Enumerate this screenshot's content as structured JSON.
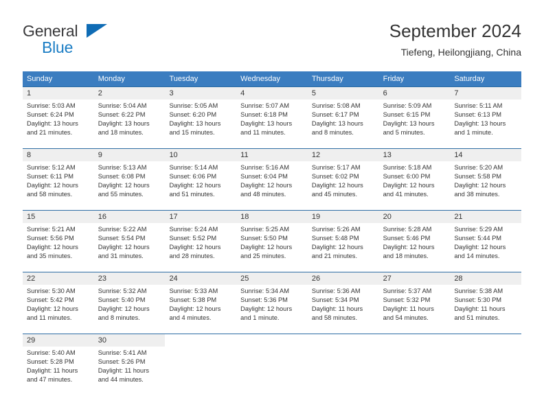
{
  "brand": {
    "name_part1": "General",
    "name_part2": "Blue",
    "logo_icon": "triangle-flag-icon"
  },
  "header": {
    "title": "September 2024",
    "location": "Tiefeng, Heilongjiang, China"
  },
  "colors": {
    "header_blue": "#3b7dc0",
    "row_border_blue": "#2e6da4",
    "day_band_gray": "#efefef",
    "brand_blue": "#1b7dc4",
    "text": "#333333"
  },
  "weekdays": [
    "Sunday",
    "Monday",
    "Tuesday",
    "Wednesday",
    "Thursday",
    "Friday",
    "Saturday"
  ],
  "weeks": [
    [
      {
        "day": "1",
        "sunrise": "Sunrise: 5:03 AM",
        "sunset": "Sunset: 6:24 PM",
        "daylight1": "Daylight: 13 hours",
        "daylight2": "and 21 minutes."
      },
      {
        "day": "2",
        "sunrise": "Sunrise: 5:04 AM",
        "sunset": "Sunset: 6:22 PM",
        "daylight1": "Daylight: 13 hours",
        "daylight2": "and 18 minutes."
      },
      {
        "day": "3",
        "sunrise": "Sunrise: 5:05 AM",
        "sunset": "Sunset: 6:20 PM",
        "daylight1": "Daylight: 13 hours",
        "daylight2": "and 15 minutes."
      },
      {
        "day": "4",
        "sunrise": "Sunrise: 5:07 AM",
        "sunset": "Sunset: 6:18 PM",
        "daylight1": "Daylight: 13 hours",
        "daylight2": "and 11 minutes."
      },
      {
        "day": "5",
        "sunrise": "Sunrise: 5:08 AM",
        "sunset": "Sunset: 6:17 PM",
        "daylight1": "Daylight: 13 hours",
        "daylight2": "and 8 minutes."
      },
      {
        "day": "6",
        "sunrise": "Sunrise: 5:09 AM",
        "sunset": "Sunset: 6:15 PM",
        "daylight1": "Daylight: 13 hours",
        "daylight2": "and 5 minutes."
      },
      {
        "day": "7",
        "sunrise": "Sunrise: 5:11 AM",
        "sunset": "Sunset: 6:13 PM",
        "daylight1": "Daylight: 13 hours",
        "daylight2": "and 1 minute."
      }
    ],
    [
      {
        "day": "8",
        "sunrise": "Sunrise: 5:12 AM",
        "sunset": "Sunset: 6:11 PM",
        "daylight1": "Daylight: 12 hours",
        "daylight2": "and 58 minutes."
      },
      {
        "day": "9",
        "sunrise": "Sunrise: 5:13 AM",
        "sunset": "Sunset: 6:08 PM",
        "daylight1": "Daylight: 12 hours",
        "daylight2": "and 55 minutes."
      },
      {
        "day": "10",
        "sunrise": "Sunrise: 5:14 AM",
        "sunset": "Sunset: 6:06 PM",
        "daylight1": "Daylight: 12 hours",
        "daylight2": "and 51 minutes."
      },
      {
        "day": "11",
        "sunrise": "Sunrise: 5:16 AM",
        "sunset": "Sunset: 6:04 PM",
        "daylight1": "Daylight: 12 hours",
        "daylight2": "and 48 minutes."
      },
      {
        "day": "12",
        "sunrise": "Sunrise: 5:17 AM",
        "sunset": "Sunset: 6:02 PM",
        "daylight1": "Daylight: 12 hours",
        "daylight2": "and 45 minutes."
      },
      {
        "day": "13",
        "sunrise": "Sunrise: 5:18 AM",
        "sunset": "Sunset: 6:00 PM",
        "daylight1": "Daylight: 12 hours",
        "daylight2": "and 41 minutes."
      },
      {
        "day": "14",
        "sunrise": "Sunrise: 5:20 AM",
        "sunset": "Sunset: 5:58 PM",
        "daylight1": "Daylight: 12 hours",
        "daylight2": "and 38 minutes."
      }
    ],
    [
      {
        "day": "15",
        "sunrise": "Sunrise: 5:21 AM",
        "sunset": "Sunset: 5:56 PM",
        "daylight1": "Daylight: 12 hours",
        "daylight2": "and 35 minutes."
      },
      {
        "day": "16",
        "sunrise": "Sunrise: 5:22 AM",
        "sunset": "Sunset: 5:54 PM",
        "daylight1": "Daylight: 12 hours",
        "daylight2": "and 31 minutes."
      },
      {
        "day": "17",
        "sunrise": "Sunrise: 5:24 AM",
        "sunset": "Sunset: 5:52 PM",
        "daylight1": "Daylight: 12 hours",
        "daylight2": "and 28 minutes."
      },
      {
        "day": "18",
        "sunrise": "Sunrise: 5:25 AM",
        "sunset": "Sunset: 5:50 PM",
        "daylight1": "Daylight: 12 hours",
        "daylight2": "and 25 minutes."
      },
      {
        "day": "19",
        "sunrise": "Sunrise: 5:26 AM",
        "sunset": "Sunset: 5:48 PM",
        "daylight1": "Daylight: 12 hours",
        "daylight2": "and 21 minutes."
      },
      {
        "day": "20",
        "sunrise": "Sunrise: 5:28 AM",
        "sunset": "Sunset: 5:46 PM",
        "daylight1": "Daylight: 12 hours",
        "daylight2": "and 18 minutes."
      },
      {
        "day": "21",
        "sunrise": "Sunrise: 5:29 AM",
        "sunset": "Sunset: 5:44 PM",
        "daylight1": "Daylight: 12 hours",
        "daylight2": "and 14 minutes."
      }
    ],
    [
      {
        "day": "22",
        "sunrise": "Sunrise: 5:30 AM",
        "sunset": "Sunset: 5:42 PM",
        "daylight1": "Daylight: 12 hours",
        "daylight2": "and 11 minutes."
      },
      {
        "day": "23",
        "sunrise": "Sunrise: 5:32 AM",
        "sunset": "Sunset: 5:40 PM",
        "daylight1": "Daylight: 12 hours",
        "daylight2": "and 8 minutes."
      },
      {
        "day": "24",
        "sunrise": "Sunrise: 5:33 AM",
        "sunset": "Sunset: 5:38 PM",
        "daylight1": "Daylight: 12 hours",
        "daylight2": "and 4 minutes."
      },
      {
        "day": "25",
        "sunrise": "Sunrise: 5:34 AM",
        "sunset": "Sunset: 5:36 PM",
        "daylight1": "Daylight: 12 hours",
        "daylight2": "and 1 minute."
      },
      {
        "day": "26",
        "sunrise": "Sunrise: 5:36 AM",
        "sunset": "Sunset: 5:34 PM",
        "daylight1": "Daylight: 11 hours",
        "daylight2": "and 58 minutes."
      },
      {
        "day": "27",
        "sunrise": "Sunrise: 5:37 AM",
        "sunset": "Sunset: 5:32 PM",
        "daylight1": "Daylight: 11 hours",
        "daylight2": "and 54 minutes."
      },
      {
        "day": "28",
        "sunrise": "Sunrise: 5:38 AM",
        "sunset": "Sunset: 5:30 PM",
        "daylight1": "Daylight: 11 hours",
        "daylight2": "and 51 minutes."
      }
    ],
    [
      {
        "day": "29",
        "sunrise": "Sunrise: 5:40 AM",
        "sunset": "Sunset: 5:28 PM",
        "daylight1": "Daylight: 11 hours",
        "daylight2": "and 47 minutes."
      },
      {
        "day": "30",
        "sunrise": "Sunrise: 5:41 AM",
        "sunset": "Sunset: 5:26 PM",
        "daylight1": "Daylight: 11 hours",
        "daylight2": "and 44 minutes."
      },
      {
        "day": "",
        "sunrise": "",
        "sunset": "",
        "daylight1": "",
        "daylight2": ""
      },
      {
        "day": "",
        "sunrise": "",
        "sunset": "",
        "daylight1": "",
        "daylight2": ""
      },
      {
        "day": "",
        "sunrise": "",
        "sunset": "",
        "daylight1": "",
        "daylight2": ""
      },
      {
        "day": "",
        "sunrise": "",
        "sunset": "",
        "daylight1": "",
        "daylight2": ""
      },
      {
        "day": "",
        "sunrise": "",
        "sunset": "",
        "daylight1": "",
        "daylight2": ""
      }
    ]
  ]
}
